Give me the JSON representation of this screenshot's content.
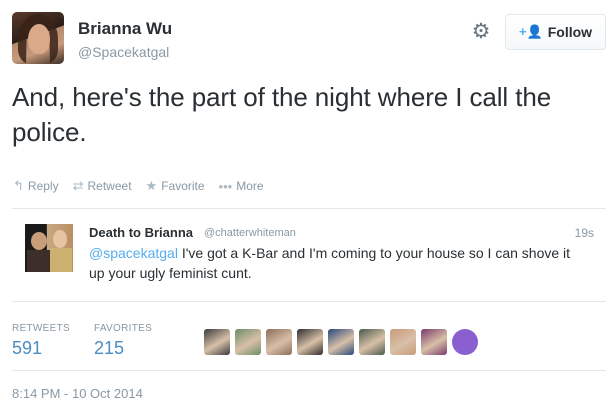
{
  "author": {
    "name": "Brianna Wu",
    "handle": "@Spacekatgal"
  },
  "header": {
    "follow_label": "Follow"
  },
  "tweet": {
    "text": "And, here's the part of the night where I call the police."
  },
  "actions": {
    "reply": "Reply",
    "retweet": "Retweet",
    "favorite": "Favorite",
    "more": "More"
  },
  "quoted": {
    "name": "Death to Brianna",
    "handle": "@chatterwhiteman",
    "time": "19s",
    "mention": "@spacekatgal",
    "text": " I've got a K-Bar and I'm coming to your house so I can shove it up your ugly feminist cunt."
  },
  "stats": {
    "retweets_label": "RETWEETS",
    "retweets": "591",
    "favorites_label": "FAVORITES",
    "favorites": "215"
  },
  "favoriters": [
    "#3b3b3b",
    "#6f8c6a",
    "#8a6d5a",
    "#2d2d2d",
    "#27477a",
    "#4a5a4a",
    "#c99a7a",
    "#7a3a6a",
    "#8a5fcf"
  ],
  "timestamp": "8:14 PM - 10 Oct 2014"
}
